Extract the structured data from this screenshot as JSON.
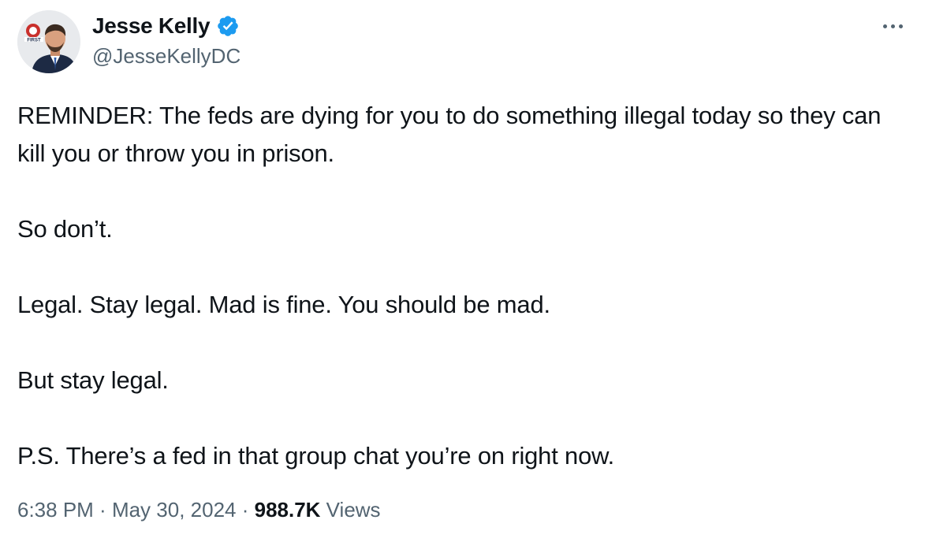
{
  "author": {
    "display_name": "Jesse Kelly",
    "handle": "@JesseKellyDC",
    "verified": true,
    "avatar_badge": "FIRST"
  },
  "menu": {
    "more_icon": "more-horizontal-icon"
  },
  "tweet": {
    "paragraphs": [
      "REMINDER: The feds are dying for you to do something illegal today so they can kill you or throw you in prison.",
      "So don’t.",
      "Legal. Stay legal. Mad is fine. You should be mad.",
      "But stay legal.",
      "P.S. There’s a fed in that group chat you’re on right now."
    ]
  },
  "meta": {
    "time": "6:38 PM",
    "separator1": " · ",
    "date": "May 30, 2024",
    "separator2": " · ",
    "views_count": "988.7K",
    "views_label": " Views"
  },
  "colors": {
    "text_primary": "#0f1419",
    "text_secondary": "#536471",
    "verified_blue": "#1d9bf0"
  }
}
